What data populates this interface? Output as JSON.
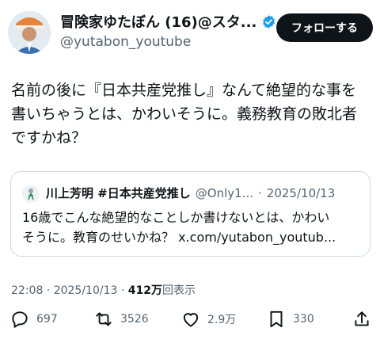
{
  "tweet": {
    "display_name": "冒険家ゆたぼん (16)@スタ...",
    "handle": "@yutabon_youtube",
    "follow_label": "フォローする",
    "text": "名前の後に『日本共産党推し』なんて絶望的な事を\n書いちゃうとは、かわいそうに。義務教育の敗北者\nですかね？",
    "quote": {
      "name": "川上芳明 #日本共産党推し",
      "handle": "@Only1...",
      "separator": "·",
      "date": "2025/10/13",
      "text": "16歳でこんな絶望的なことしか書けないとは、かわい\nそうに。教育のせいかね？ x.com/yutabon_youtub..."
    },
    "time": "22:08 · 2025/10/13 · ",
    "views_count": "412万",
    "views_label": "回表示",
    "actions": {
      "replies": "697",
      "retweets": "3526",
      "likes": "2.9万",
      "bookmarks": "330"
    }
  },
  "colors": {
    "accent": "#1d9bf0",
    "text": "#0f1419",
    "muted": "#536471",
    "border": "#cfd9de"
  }
}
